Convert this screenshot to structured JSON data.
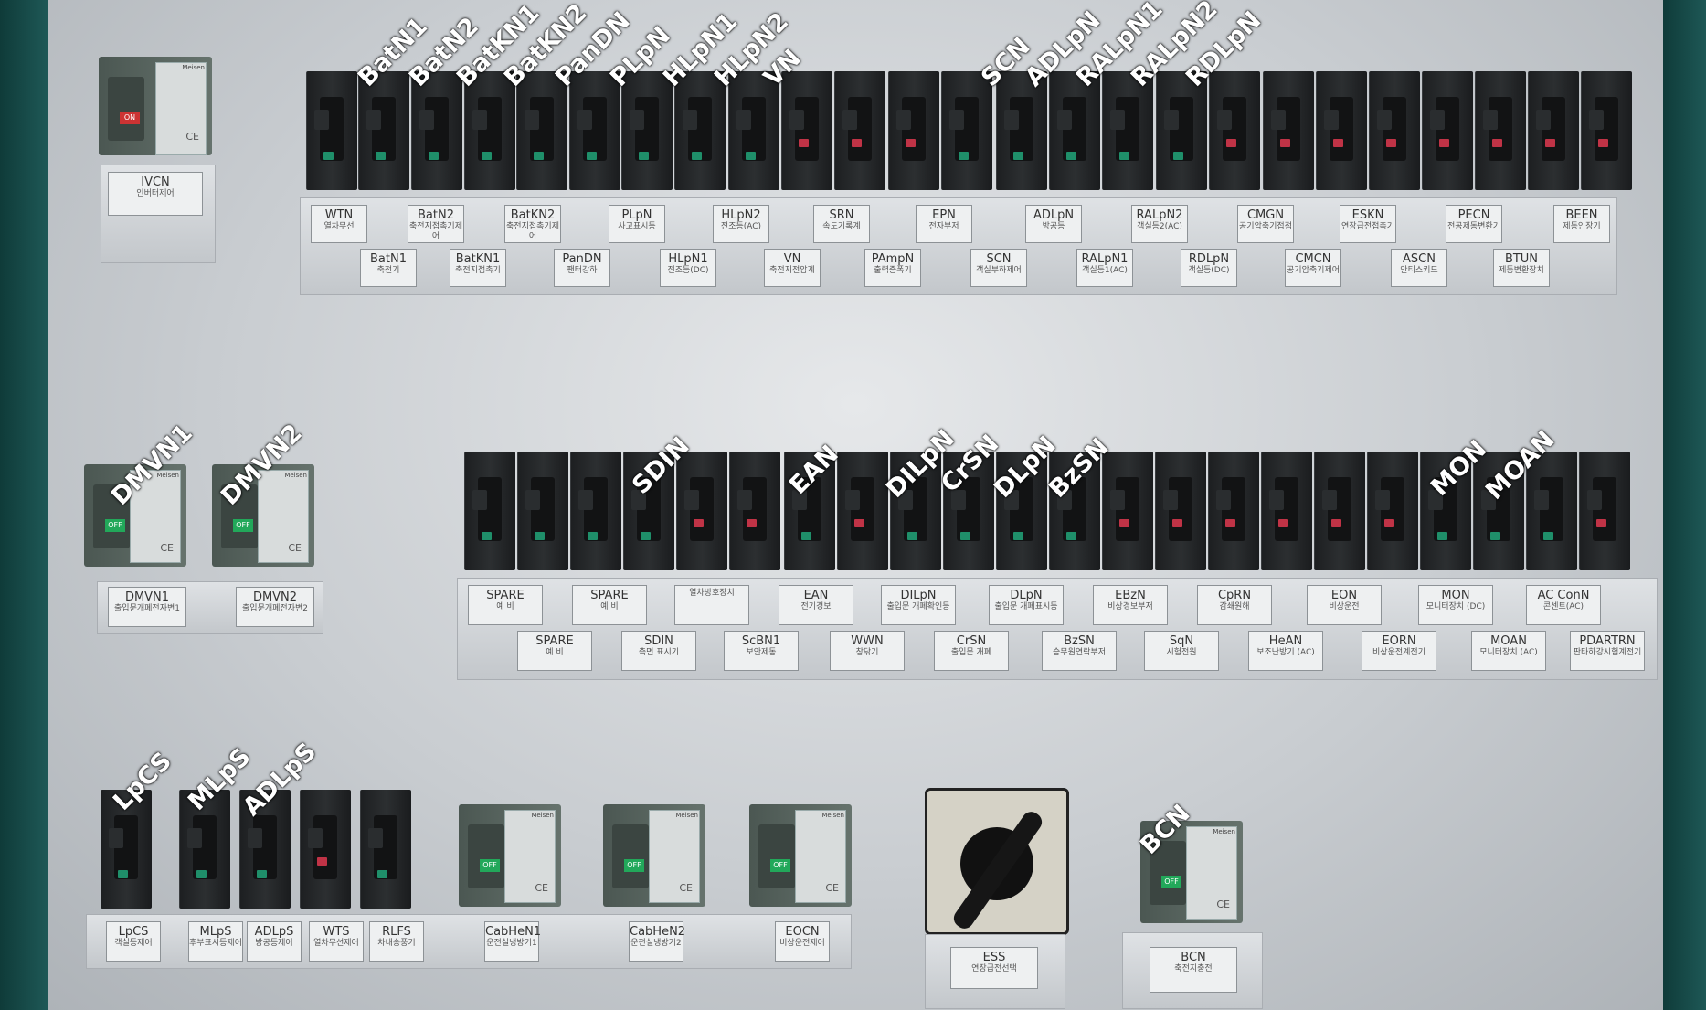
{
  "top_tags": [
    "BatN1",
    "BatN2",
    "BatKN1",
    "BatKN2",
    "PanDN",
    "PLpN",
    "HLpN1",
    "HLpN2",
    "VN",
    "SCN",
    "ADLpN",
    "RALpN1",
    "RALpN2",
    "RDLpN"
  ],
  "top_labels_row1": [
    {
      "t": "WTN",
      "s": "열차무선"
    },
    {
      "t": "BatN2",
      "s": "축전지접촉기제어"
    },
    {
      "t": "BatKN2",
      "s": "축전지접촉기제어"
    },
    {
      "t": "PLpN",
      "s": "사고표시등"
    },
    {
      "t": "HLpN2",
      "s": "전조등(AC)"
    },
    {
      "t": "SRN",
      "s": "속도기록계"
    },
    {
      "t": "EPN",
      "s": "전자부저"
    },
    {
      "t": "ADLpN",
      "s": "방공등"
    },
    {
      "t": "RALpN2",
      "s": "객실등2(AC)"
    },
    {
      "t": "CMGN",
      "s": "공기압축기접점"
    },
    {
      "t": "ESKN",
      "s": "연장급전접촉기"
    },
    {
      "t": "PECN",
      "s": "전공제동변환기"
    },
    {
      "t": "BEEN",
      "s": "제동인장기"
    }
  ],
  "top_labels_row2": [
    {
      "t": "BatN1",
      "s": "축전기"
    },
    {
      "t": "BatKN1",
      "s": "축전지접촉기"
    },
    {
      "t": "PanDN",
      "s": "팬터강하"
    },
    {
      "t": "HLpN1",
      "s": "전조등(DC)"
    },
    {
      "t": "VN",
      "s": "축전지전압계"
    },
    {
      "t": "PAmpN",
      "s": "출력증폭기"
    },
    {
      "t": "SCN",
      "s": "객실부하제어"
    },
    {
      "t": "RALpN1",
      "s": "객실등1(AC)"
    },
    {
      "t": "RDLpN",
      "s": "객실등(DC)"
    },
    {
      "t": "CMCN",
      "s": "공기압축기제어"
    },
    {
      "t": "ASCN",
      "s": "안티스키드"
    },
    {
      "t": "BTUN",
      "s": "제동변환장치"
    }
  ],
  "ivcn": {
    "t": "IVCN",
    "s": "인버터제어"
  },
  "mid_tags": [
    "DMVN1",
    "DMVN2",
    "SDIN",
    "EAN",
    "DILpN",
    "CrSN",
    "DLpN",
    "BzSN",
    "MON",
    "MOAN"
  ],
  "dmvn_labels": [
    {
      "t": "DMVN1",
      "s": "출입문개폐전자변1"
    },
    {
      "t": "DMVN2",
      "s": "출입문개폐전자변2"
    }
  ],
  "mid_labels_row1": [
    {
      "t": "SPARE",
      "s": "예  비"
    },
    {
      "t": "SPARE",
      "s": "예  비"
    },
    {
      "t": "",
      "s": "열차방호장치"
    },
    {
      "t": "EAN",
      "s": "전기경보"
    },
    {
      "t": "DILpN",
      "s": "출입문 개폐확인등"
    },
    {
      "t": "DLpN",
      "s": "출입문 개폐표시등"
    },
    {
      "t": "EBzN",
      "s": "비상경보부저"
    },
    {
      "t": "CpRN",
      "s": "감쇄원해"
    },
    {
      "t": "EON",
      "s": "비상운전"
    },
    {
      "t": "MON",
      "s": "모니터장치 (DC)"
    },
    {
      "t": "AC ConN",
      "s": "콘센트(AC)"
    }
  ],
  "mid_labels_row2": [
    {
      "t": "SPARE",
      "s": "예  비"
    },
    {
      "t": "SDIN",
      "s": "측면 표시기"
    },
    {
      "t": "ScBN1",
      "s": "보안제동"
    },
    {
      "t": "WWN",
      "s": "창닦기"
    },
    {
      "t": "CrSN",
      "s": "출입문 개폐"
    },
    {
      "t": "BzSN",
      "s": "승무원연락부저"
    },
    {
      "t": "SqN",
      "s": "시험전원"
    },
    {
      "t": "HeAN",
      "s": "보조난방기 (AC)"
    },
    {
      "t": "EORN",
      "s": "비상운전계전기"
    },
    {
      "t": "MOAN",
      "s": "모니터장치 (AC)"
    },
    {
      "t": "PDARTRN",
      "s": "판타하강시험계전기"
    }
  ],
  "bottom_tags": [
    "LpCS",
    "MLpS",
    "ADLpS",
    "BCN"
  ],
  "bottom_labels": [
    {
      "t": "LpCS",
      "s": "객실등제어"
    },
    {
      "t": "MLpS",
      "s": "후부표시등제어"
    },
    {
      "t": "ADLpS",
      "s": "방공등제어"
    },
    {
      "t": "WTS",
      "s": "열차무선제어"
    },
    {
      "t": "RLFS",
      "s": "차내송풍기"
    },
    {
      "t": "CabHeN1",
      "s": "운전실냉방기1"
    },
    {
      "t": "CabHeN2",
      "s": "운전실냉방기2"
    },
    {
      "t": "EOCN",
      "s": "비상운전제어"
    }
  ],
  "ess": {
    "t": "ESS",
    "s": "연장급전선택"
  },
  "bcn": {
    "t": "BCN",
    "s": "축전지충전"
  },
  "switch_states": {
    "off": "OFF",
    "on": "ON"
  },
  "brand": "Meisen"
}
